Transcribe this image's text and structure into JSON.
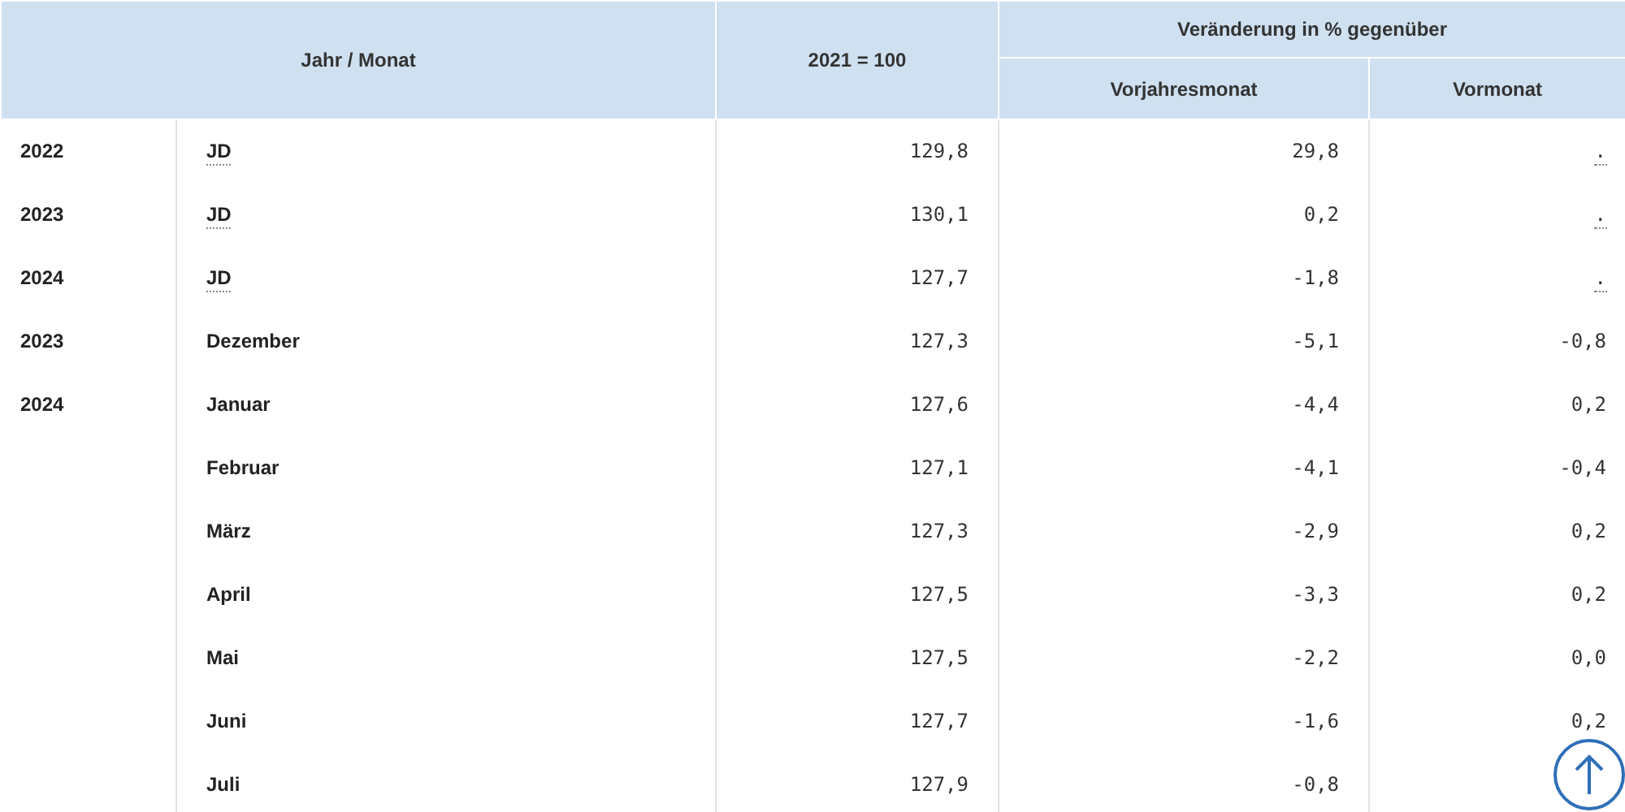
{
  "table": {
    "columns": {
      "period": "Jahr / Monat",
      "index": "2021 = 100",
      "change_group": "Veränderung in % gegenüber",
      "change_year": "Vorjahresmonat",
      "change_month": "Vormonat"
    },
    "rows": [
      {
        "year": "2022",
        "month": "JD",
        "month_abbr": true,
        "index": "129,8",
        "change_year": "29,8",
        "change_month": ".",
        "change_month_abbr": true
      },
      {
        "year": "2023",
        "month": "JD",
        "month_abbr": true,
        "index": "130,1",
        "change_year": "0,2",
        "change_month": ".",
        "change_month_abbr": true
      },
      {
        "year": "2024",
        "month": "JD",
        "month_abbr": true,
        "index": "127,7",
        "change_year": "-1,8",
        "change_month": ".",
        "change_month_abbr": true
      },
      {
        "year": "2023",
        "month": "Dezember",
        "month_abbr": false,
        "index": "127,3",
        "change_year": "-5,1",
        "change_month": "-0,8",
        "change_month_abbr": false
      },
      {
        "year": "2024",
        "month": "Januar",
        "month_abbr": false,
        "index": "127,6",
        "change_year": "-4,4",
        "change_month": "0,2",
        "change_month_abbr": false
      },
      {
        "month": "Februar",
        "month_abbr": false,
        "index": "127,1",
        "change_year": "-4,1",
        "change_month": "-0,4",
        "change_month_abbr": false
      },
      {
        "month": "März",
        "month_abbr": false,
        "index": "127,3",
        "change_year": "-2,9",
        "change_month": "0,2",
        "change_month_abbr": false
      },
      {
        "month": "April",
        "month_abbr": false,
        "index": "127,5",
        "change_year": "-3,3",
        "change_month": "0,2",
        "change_month_abbr": false
      },
      {
        "month": "Mai",
        "month_abbr": false,
        "index": "127,5",
        "change_year": "-2,2",
        "change_month": "0,0",
        "change_month_abbr": false
      },
      {
        "month": "Juni",
        "month_abbr": false,
        "index": "127,7",
        "change_year": "-1,6",
        "change_month": "0,2",
        "change_month_abbr": false
      },
      {
        "month": "Juli",
        "month_abbr": false,
        "index": "127,9",
        "change_year": "-0,8"
      }
    ]
  },
  "back_to_top": {
    "visible": true
  }
}
